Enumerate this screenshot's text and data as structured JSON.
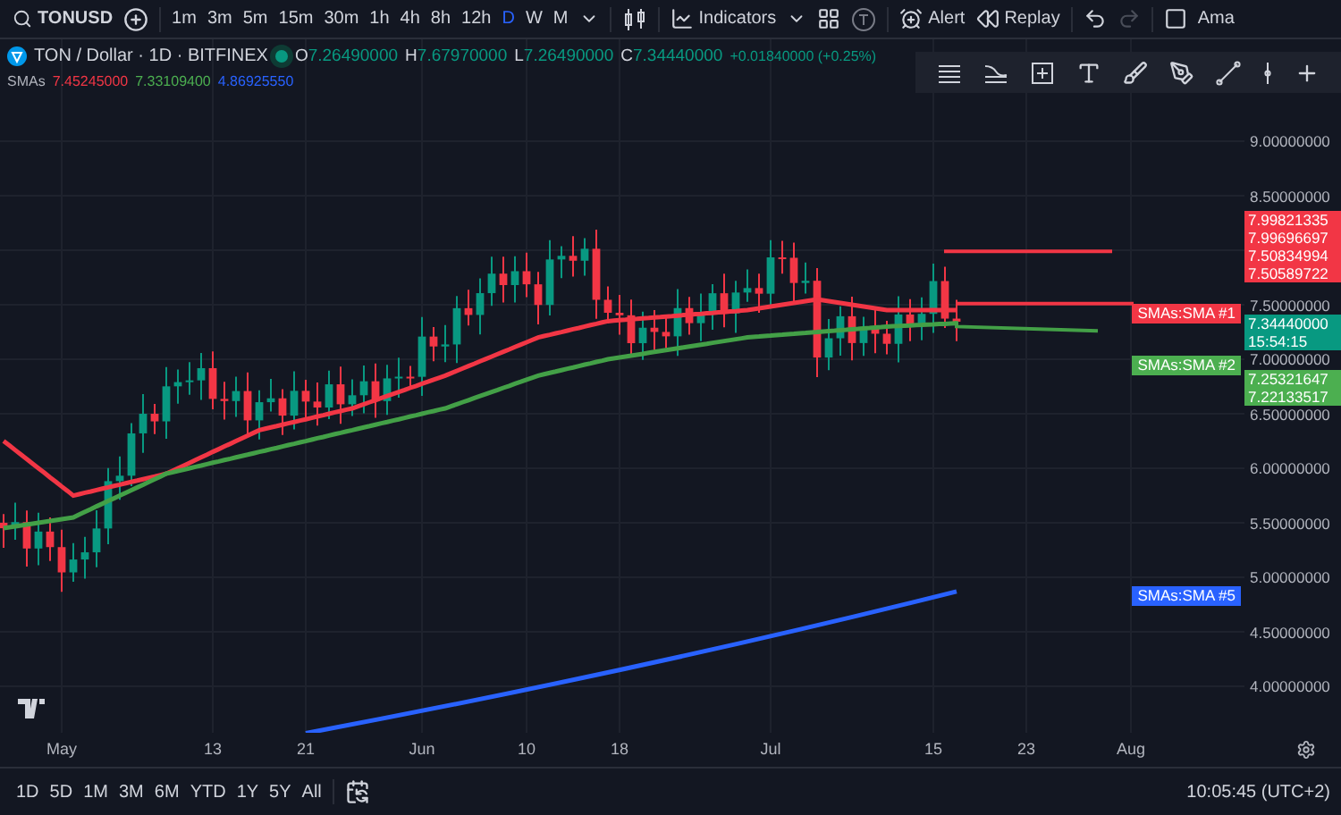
{
  "toolbar": {
    "symbol": "TONUSD",
    "intervals": [
      {
        "label": "1m",
        "selected": false
      },
      {
        "label": "3m",
        "selected": false
      },
      {
        "label": "5m",
        "selected": false
      },
      {
        "label": "15m",
        "selected": false
      },
      {
        "label": "30m",
        "selected": false
      },
      {
        "label": "1h",
        "selected": false
      },
      {
        "label": "4h",
        "selected": false
      },
      {
        "label": "8h",
        "selected": false
      },
      {
        "label": "12h",
        "selected": false
      },
      {
        "label": "D",
        "selected": true
      },
      {
        "label": "W",
        "selected": false
      },
      {
        "label": "M",
        "selected": false
      }
    ],
    "indicators": "Indicators",
    "alert": "Alert",
    "replay": "Replay",
    "account": "Ama"
  },
  "legend": {
    "title": "TON / Dollar · 1D · BITFINEX",
    "ohlc": [
      {
        "key": "O",
        "value": "7.26490000"
      },
      {
        "key": "H",
        "value": "7.67970000"
      },
      {
        "key": "L",
        "value": "7.26490000"
      },
      {
        "key": "C",
        "value": "7.34440000"
      }
    ],
    "change": "+0.01840000 (+0.25%)",
    "study": "SMAs",
    "study_values": [
      {
        "value": "7.45245000",
        "color": "#f23645"
      },
      {
        "value": "7.33109400",
        "color": "#4caf50"
      },
      {
        "value": "4.86925550",
        "color": "#2962ff"
      }
    ]
  },
  "price_axis": [
    "9.00000000",
    "8.50000000",
    "7.50000000",
    "7.00000000",
    "6.50000000",
    "6.00000000",
    "5.50000000",
    "5.00000000",
    "4.50000000",
    "4.00000000"
  ],
  "axis_tags": [
    {
      "color": "#f23645",
      "labels": [
        "7.99821335",
        "7.99696697",
        "7.50834994",
        "7.50589722"
      ]
    },
    {
      "color": "#089981",
      "labels": [
        "7.34440000",
        "15:54:15"
      ]
    },
    {
      "color": "#4caf50",
      "labels": [
        "7.25321647",
        "7.22133517"
      ]
    }
  ],
  "series_tags": [
    {
      "label": "SMAs:SMA #1",
      "color": "#f23645"
    },
    {
      "label": "SMAs:SMA #2",
      "color": "#4caf50"
    },
    {
      "label": "SMAs:SMA #5",
      "color": "#2962ff"
    }
  ],
  "time_axis": [
    "May",
    "13",
    "21",
    "Jun",
    "10",
    "18",
    "Jul",
    "15",
    "23",
    "Aug"
  ],
  "range_bar": {
    "ranges": [
      "1D",
      "5D",
      "1M",
      "3M",
      "6M",
      "YTD",
      "1Y",
      "5Y",
      "All"
    ],
    "clock": "10:05:45 (UTC+2)"
  }
}
